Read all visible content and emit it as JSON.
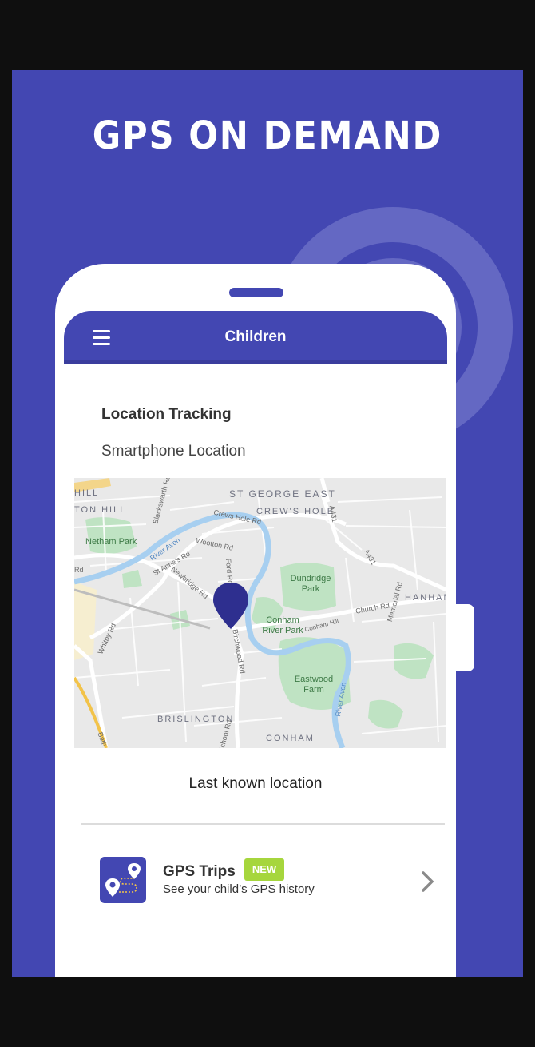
{
  "colors": {
    "brand": "#4347b2",
    "badge": "#a6d63d",
    "background": "#0f0f0f"
  },
  "headline": "GPS ON DEMAND",
  "appbar": {
    "title": "Children",
    "menu_icon": "hamburger-menu-icon"
  },
  "section": {
    "title": "Location Tracking",
    "subtitle": "Smartphone Location"
  },
  "map": {
    "marker_icon": "location-pin-icon",
    "labels": {
      "st_george_east": "ST GEORGE EAST",
      "crews_hole": "CREW'S HOLE",
      "hill": "HILL",
      "ton_hill": "TON HILL",
      "netham_park": "Netham Park",
      "river_avon": "River Avon",
      "crews_hole_rd": "Crews Hole Rd",
      "wootton_rd": "Wootton Rd",
      "st_annes_rd": "St Anne's Rd",
      "newbridge_rd": "Newbridge Rd",
      "blackswarth_rd": "Blackswarth Rd",
      "a431": "A431",
      "a431_b": "A431",
      "dundridge_park": "Dundridge Park",
      "conham_river_park": "Conham River Park",
      "conham_hill": "Conham Hill",
      "church_rd": "Church Rd",
      "memorial_rd": "Memorial Rd",
      "hanham": "HANHAM",
      "eastwood_farm": "Eastwood Farm",
      "river_avon_2": "River Avon",
      "birchwood_rd": "Birchwood Rd",
      "whitby_rd": "Whitby Rd",
      "brislington": "BRISLINGTON",
      "conham": "CONHAM",
      "bath": "Bath",
      "rd_left": "Rd",
      "school_rd": "School Rd",
      "ford_rd": "Ford Rd"
    }
  },
  "last_known": "Last known location",
  "trips": {
    "title": "GPS Trips",
    "badge": "NEW",
    "subtitle": "See your child’s GPS history",
    "icon": "gps-trips-icon",
    "chevron": "chevron-right-icon"
  }
}
